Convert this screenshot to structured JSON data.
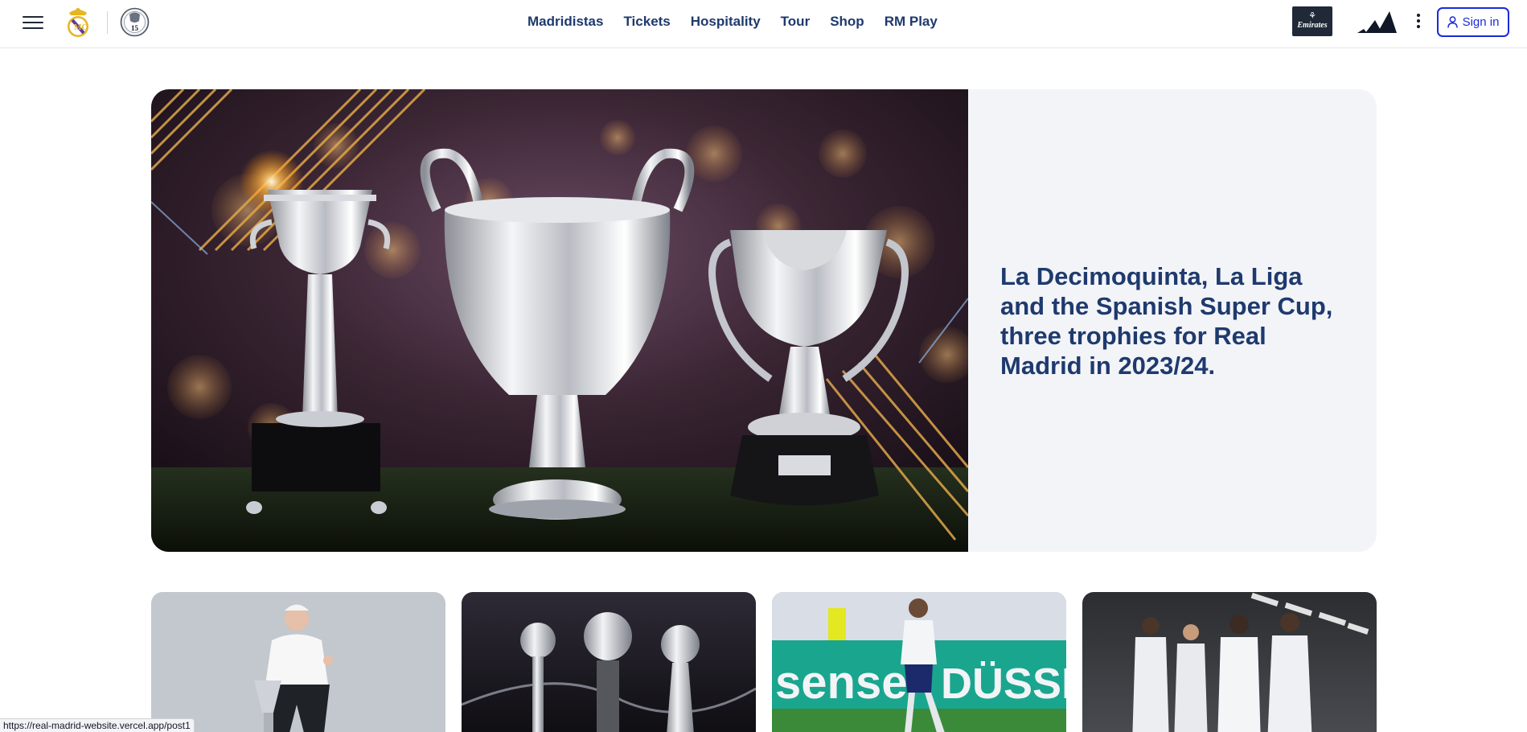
{
  "header": {
    "nav": [
      {
        "label": "Madridistas"
      },
      {
        "label": "Tickets"
      },
      {
        "label": "Hospitality"
      },
      {
        "label": "Tour"
      },
      {
        "label": "Shop"
      },
      {
        "label": "RM Play"
      }
    ],
    "sponsor_text": "Emirates",
    "signin_label": "Sign in",
    "badge_number": "15"
  },
  "hero": {
    "title": "La Decimoquinta, La Liga and the Spanish Super Cup, three trophies for Real Madrid in 2023/24.",
    "image": "three-trophies-photo"
  },
  "cards": [
    {
      "image": "player-with-trophy-photo"
    },
    {
      "image": "basketball-trophies-photo"
    },
    {
      "image": "player-running-stadium-photo"
    },
    {
      "image": "team-white-kit-photo"
    }
  ],
  "status": {
    "url": "https://real-madrid-website.vercel.app/post1"
  },
  "colors": {
    "navy": "#1e3a6e",
    "accent_blue": "#1d2ad8",
    "hero_panel": "#f3f4f8"
  }
}
